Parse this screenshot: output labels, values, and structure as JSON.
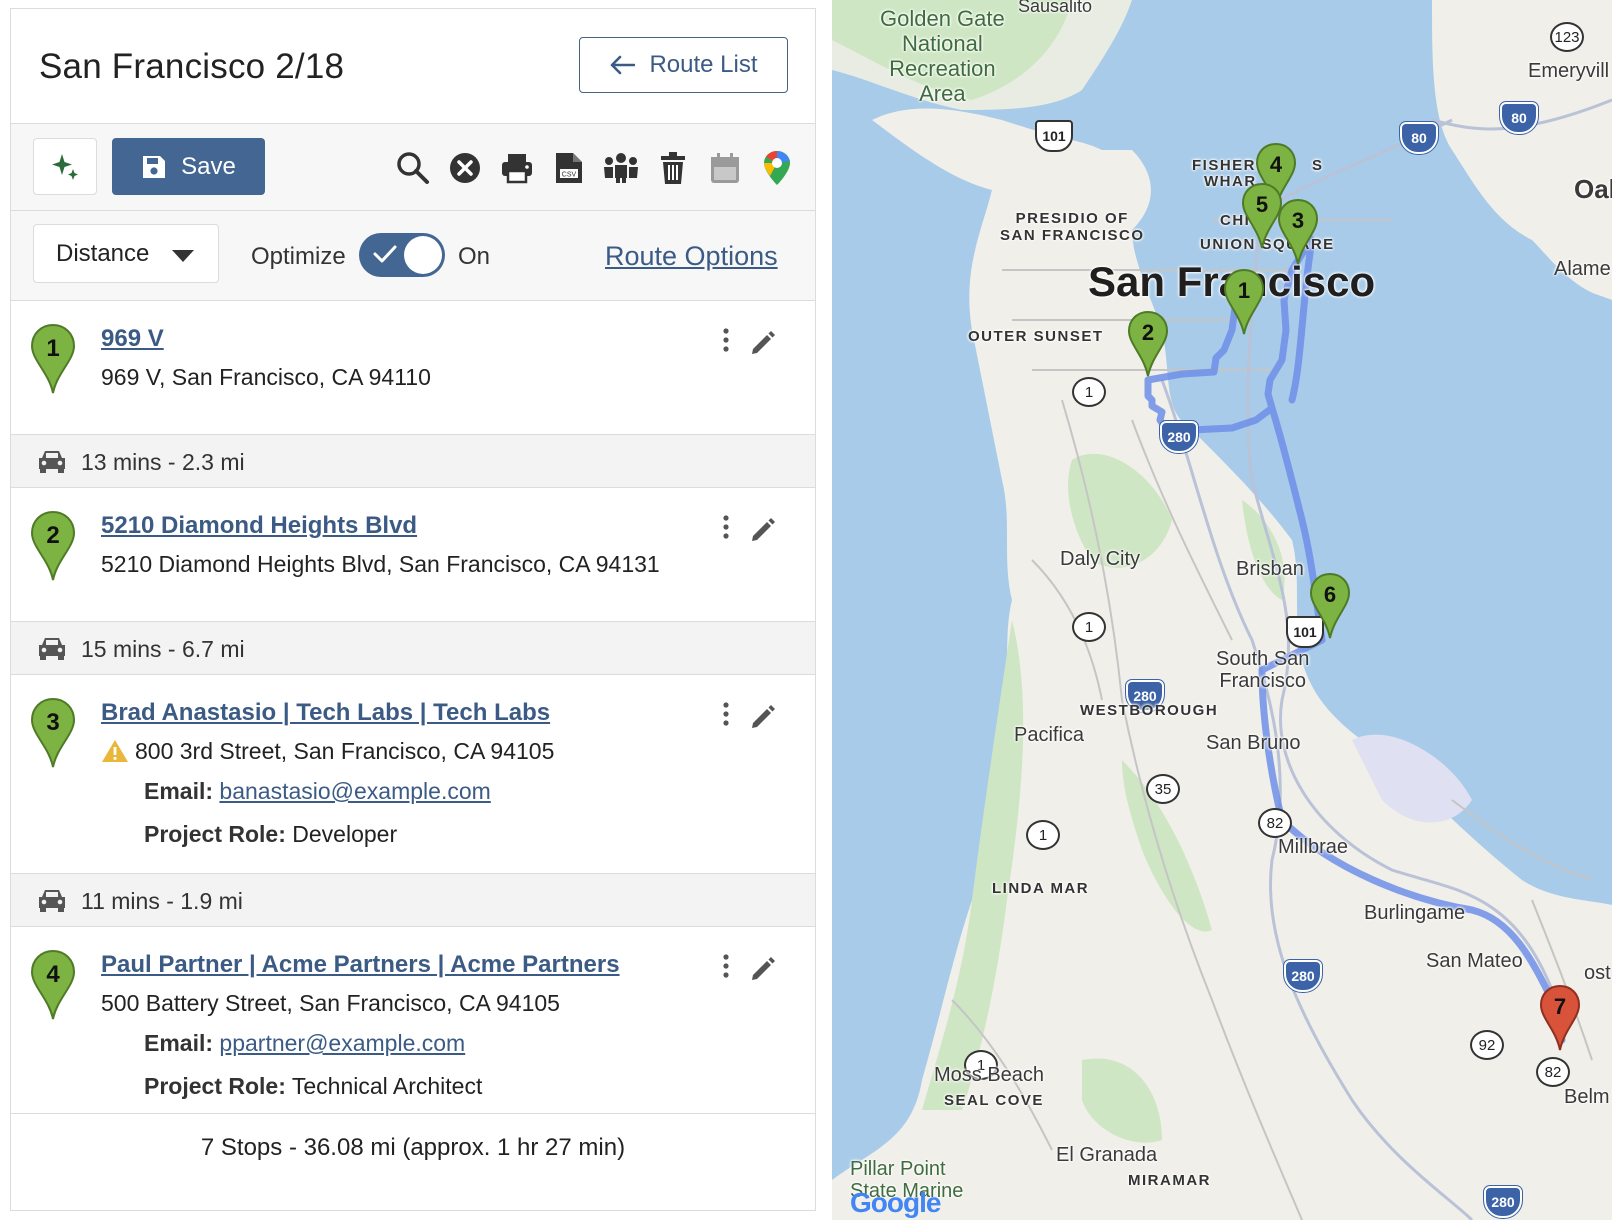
{
  "header": {
    "title": "San Francisco 2/18",
    "route_list_label": "Route List"
  },
  "toolbar": {
    "save_label": "Save",
    "icons": [
      "magic-wand-icon",
      "save-icon",
      "search-icon",
      "clear-icon",
      "print-icon",
      "csv-icon",
      "team-icon",
      "trash-icon",
      "calendar-icon",
      "google-maps-icon"
    ]
  },
  "options": {
    "sort_value": "Distance",
    "optimize_label": "Optimize",
    "optimize_state": "On",
    "route_options_label": "Route Options"
  },
  "stops": [
    {
      "number": "1",
      "name": "969 V",
      "address": "969 V, San Francisco, CA 94110"
    },
    {
      "number": "2",
      "name": "5210 Diamond Heights Blvd",
      "address": "5210 Diamond Heights Blvd, San Francisco, CA 94131"
    },
    {
      "number": "3",
      "name": "Brad Anastasio | Tech Labs | Tech Labs",
      "address": "800 3rd Street, San Francisco, CA 94105",
      "email_label": "Email:",
      "email": "banastasio@example.com",
      "role_label": "Project Role:",
      "role": "Developer"
    },
    {
      "number": "4",
      "name": "Paul Partner | Acme Partners | Acme Partners",
      "address": "500 Battery Street, San Francisco, CA 94105",
      "email_label": "Email:",
      "email": "ppartner@example.com",
      "role_label": "Project Role:",
      "role": "Technical Architect"
    }
  ],
  "legs": [
    "13 mins - 2.3 mi",
    "15 mins - 6.7 mi",
    "11 mins - 1.9 mi"
  ],
  "summary": "7 Stops - 36.08 mi (approx. 1 hr 27 min)",
  "colors": {
    "accent": "#436792",
    "link": "#3b5b85",
    "pin_green": "#7cb342",
    "pin_red": "#d9533b",
    "route": "#6f8fe8"
  },
  "map": {
    "labels": {
      "sausalito": "Sausalito",
      "golden_gate": "Golden Gate\nNational\nRecreation\nArea",
      "emeryville": "Emeryvill",
      "oak": "Oak",
      "alameda": "Alame",
      "fishermans": "FISHERM",
      "fishermans2": "S",
      "whar": "WHAR",
      "presidio": "PRESIDIO OF\nSAN FRANCISCO",
      "chin": "CHIN",
      "union_square": "UNION SQUARE",
      "city": "San Francisco",
      "outer_sunset": "OUTER SUNSET",
      "daly_city": "Daly City",
      "brisbane": "Brisban",
      "south_sf": "South San\nFrancisco",
      "westborough": "WESTBOROUGH",
      "pacifica": "Pacifica",
      "san_bruno": "San Bruno",
      "millbrae": "Millbrae",
      "linda_mar": "LINDA MAR",
      "burlingame": "Burlingame",
      "san_mateo": "San Mateo",
      "foster": "ost",
      "moss_beach": "Moss Beach",
      "seal_cove": "SEAL COVE",
      "belmont": "Belm",
      "el_granada": "El Granada",
      "miramar": "MIRAMAR",
      "pillar_point": "Pillar Point\nState Marine",
      "google": "Google"
    },
    "shields": [
      "101",
      "80",
      "80",
      "123",
      "1",
      "280",
      "1",
      "280",
      "101",
      "35",
      "82",
      "1",
      "280",
      "92",
      "82",
      "1",
      "280"
    ],
    "pins": [
      "1",
      "2",
      "3",
      "4",
      "5",
      "6",
      "7"
    ]
  }
}
